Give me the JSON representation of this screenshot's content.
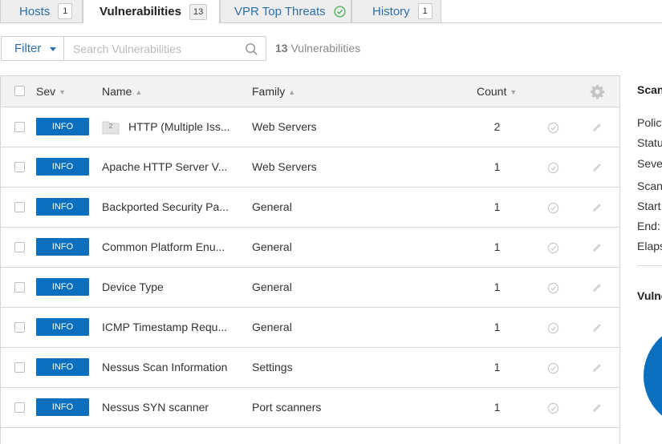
{
  "tabs": [
    {
      "label": "Hosts",
      "badge": "1"
    },
    {
      "label": "Vulnerabilities",
      "badge": "13"
    },
    {
      "label": "VPR Top Threats"
    },
    {
      "label": "History",
      "badge": "1"
    }
  ],
  "toolbar": {
    "filter_label": "Filter",
    "search_placeholder": "Search Vulnerabilities",
    "count_number": "13",
    "count_text": "Vulnerabilities"
  },
  "table": {
    "headers": {
      "sev": "Sev",
      "name": "Name",
      "family": "Family",
      "count": "Count"
    },
    "rows": [
      {
        "sev": "INFO",
        "name": "HTTP (Multiple Iss...",
        "family": "Web Servers",
        "count": "2",
        "group_count": "2"
      },
      {
        "sev": "INFO",
        "name": "Apache HTTP Server V...",
        "family": "Web Servers",
        "count": "1"
      },
      {
        "sev": "INFO",
        "name": "Backported Security Pa...",
        "family": "General",
        "count": "1"
      },
      {
        "sev": "INFO",
        "name": "Common Platform Enu...",
        "family": "General",
        "count": "1"
      },
      {
        "sev": "INFO",
        "name": "Device Type",
        "family": "General",
        "count": "1"
      },
      {
        "sev": "INFO",
        "name": "ICMP Timestamp Requ...",
        "family": "General",
        "count": "1"
      },
      {
        "sev": "INFO",
        "name": "Nessus Scan Information",
        "family": "Settings",
        "count": "1"
      },
      {
        "sev": "INFO",
        "name": "Nessus SYN scanner",
        "family": "Port scanners",
        "count": "1"
      }
    ]
  },
  "panel": {
    "scan_heading": "Scan Details",
    "labels": [
      "Policy:",
      "Status:",
      "Severity Base:",
      "Scanner:",
      "Start:",
      "End:",
      "Elapsed:"
    ],
    "vuln_heading": "Vulnerabilities"
  },
  "colors": {
    "info": "#0a6fbf",
    "link": "#2d6fa8",
    "ok": "#4caf50"
  }
}
